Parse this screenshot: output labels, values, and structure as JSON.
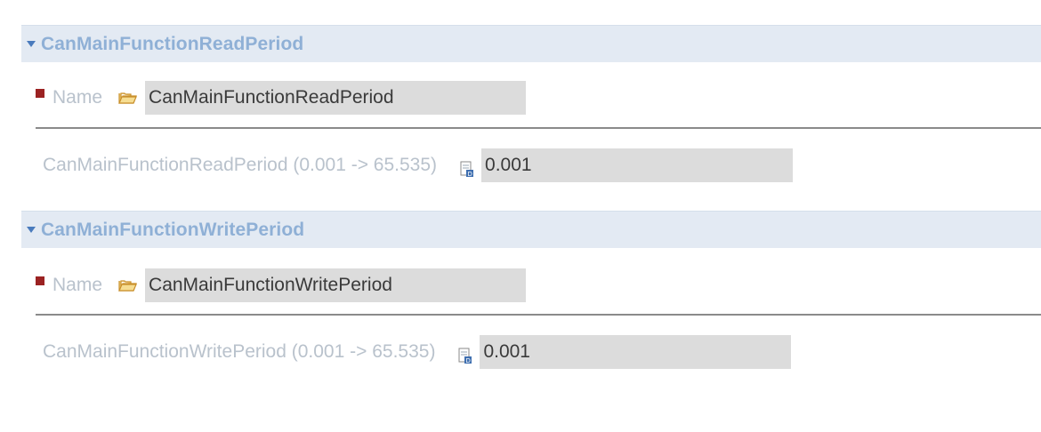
{
  "sections": [
    {
      "title": "CanMainFunctionReadPeriod",
      "name_label": "Name",
      "name_value": "CanMainFunctionReadPeriod",
      "param_label": "CanMainFunctionReadPeriod (0.001 -> 65.535)",
      "param_value": "0.001"
    },
    {
      "title": "CanMainFunctionWritePeriod",
      "name_label": "Name",
      "name_value": "CanMainFunctionWritePeriod",
      "param_label": "CanMainFunctionWritePeriod (0.001 -> 65.535)",
      "param_value": "0.001"
    }
  ],
  "colors": {
    "header_bg": "#e3eaf3",
    "header_text": "#8fb0d6",
    "required_marker": "#9b2222",
    "field_bg": "#dcdcdc",
    "label_text": "#b9c2cc"
  },
  "icons": {
    "twisty": "chevron-down-icon",
    "required": "required-marker-icon",
    "folder": "folder-open-icon",
    "parameter": "parameter-value-icon"
  }
}
